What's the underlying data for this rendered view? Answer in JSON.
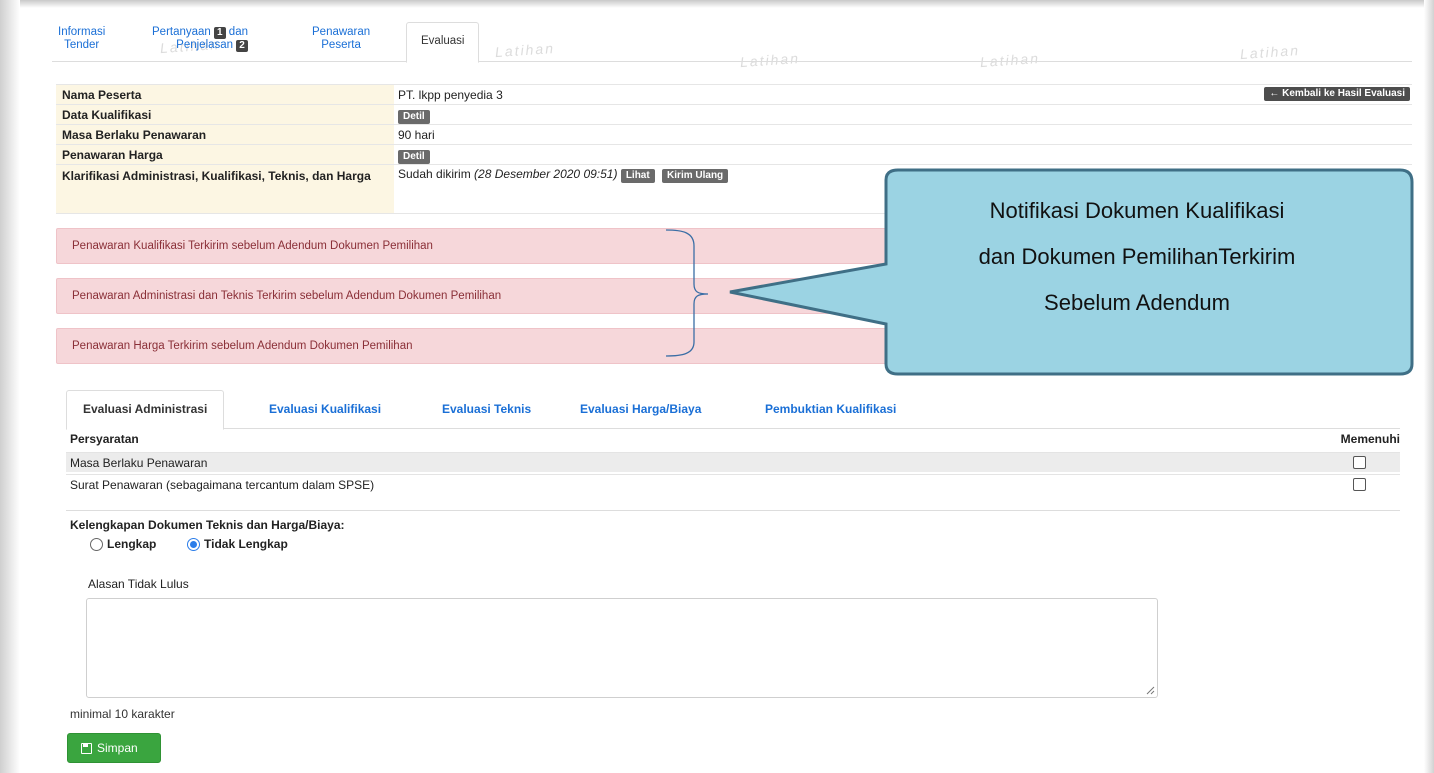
{
  "watermark_text": "Latihan",
  "top_tabs": [
    {
      "line1": "Informasi",
      "line2": "Tender"
    },
    {
      "line1": "Pertanyaan",
      "badge1": "1",
      "line1b": "dan",
      "line2": "Penjelasan",
      "badge2": "2"
    },
    {
      "line1": "Penawaran",
      "line2": "Peserta"
    },
    {
      "label": "Evaluasi"
    }
  ],
  "info": {
    "rows": [
      {
        "label": "Nama Peserta",
        "value": "PT. lkpp penyedia 3"
      },
      {
        "label": "Data Kualifikasi",
        "button": "Detil"
      },
      {
        "label": "Masa Berlaku Penawaran",
        "value": "90 hari"
      },
      {
        "label": "Penawaran Harga",
        "button": "Detil"
      },
      {
        "label": "Klarifikasi Administrasi, Kualifikasi, Teknis, dan Harga",
        "value": "Sudah dikirim",
        "date": "(28 Desember 2020 09:51)",
        "btn_lihat": "Lihat",
        "btn_kirim": "Kirim Ulang"
      }
    ],
    "back_button": "← Kembali ke Hasil Evaluasi"
  },
  "alerts": [
    "Penawaran Kualifikasi Terkirim sebelum Adendum Dokumen Pemilihan",
    "Penawaran Administrasi dan Teknis Terkirim sebelum Adendum Dokumen Pemilihan",
    "Penawaran Harga Terkirim sebelum Adendum Dokumen Pemilihan"
  ],
  "callout": {
    "line1": "Notifikasi Dokumen Kualifikasi",
    "line2": "dan Dokumen PemilihanTerkirim",
    "line3": "Sebelum Adendum",
    "fill_color": "#9bd3e3",
    "border_color": "#3f6f86"
  },
  "eval_tabs": [
    "Evaluasi Administrasi",
    "Evaluasi Kualifikasi",
    "Evaluasi Teknis",
    "Evaluasi Harga/Biaya",
    "Pembuktian Kualifikasi"
  ],
  "requirements": {
    "col_left": "Persyaratan",
    "col_right": "Memenuhi",
    "rows": [
      "Masa Berlaku Penawaran",
      "Surat Penawaran (sebagaimana tercantum dalam SPSE)"
    ]
  },
  "kelengkapan": {
    "title": "Kelengkapan Dokumen Teknis dan Harga/Biaya:",
    "option1": "Lengkap",
    "option2": "Tidak Lengkap",
    "selected": "Tidak Lengkap"
  },
  "alasan": {
    "label": "Alasan Tidak Lulus",
    "value": "",
    "hint": "minimal 10 karakter"
  },
  "save_button": "Simpan",
  "colors": {
    "link": "#1a6fd6",
    "alert_bg": "#f6d7da",
    "label_bg": "#fcf6e3",
    "save_bg": "#3aa53f"
  }
}
